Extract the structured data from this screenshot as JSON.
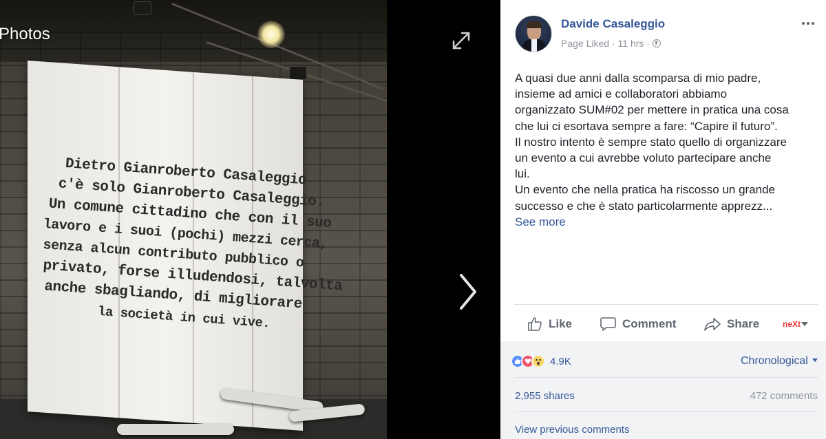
{
  "viewer": {
    "title": "Photos",
    "photo_text": {
      "line1": "Dietro Gianroberto Casaleggio",
      "line2": "c'è solo Gianroberto Casaleggio.",
      "line3": "Un comune cittadino che con il suo",
      "line4": "lavoro e i suoi (pochi) mezzi cerca,",
      "line5": "senza alcun contributo pubblico o",
      "line6": "privato, forse illudendosi, talvolta",
      "line7": "anche sbagliando, di migliorare",
      "line8": "la società in cui vive."
    }
  },
  "post": {
    "author": "Davide Casaleggio",
    "page_status": "Page Liked",
    "time": "11 hrs",
    "separator": "·",
    "text_lines": [
      "A quasi due anni dalla scomparsa di mio padre,",
      "insieme ad amici e collaboratori abbiamo",
      "organizzato SUM#02 per mettere in pratica una cosa",
      "che lui ci esortava sempre a fare: “Capire il futuro”.",
      "Il nostro intento è sempre stato quello di organizzare",
      "un evento a cui avrebbe voluto partecipare anche",
      "lui.",
      "Un evento che nella pratica ha riscosso un grande",
      "successo e che è stato particolarmente apprezz..."
    ],
    "see_more": "See more"
  },
  "actions": {
    "like": "Like",
    "comment": "Comment",
    "share": "Share",
    "next_logo": "neXt"
  },
  "stats": {
    "reactions_count": "4.9K",
    "sort": "Chronological",
    "shares": "2,955 shares",
    "comments": "472 comments",
    "view_previous": "View previous comments"
  },
  "colors": {
    "link": "#365899",
    "meta": "#90949c",
    "text": "#1d2129",
    "like_blue": "#5890ff",
    "love_red": "#f25268",
    "wow_yellow": "#fcd667"
  }
}
